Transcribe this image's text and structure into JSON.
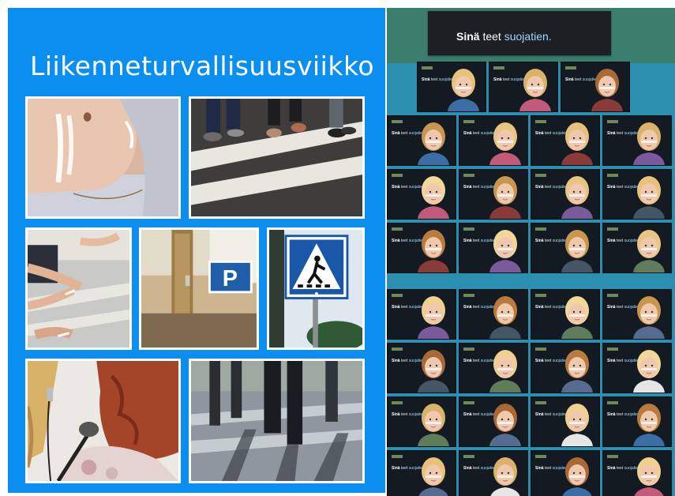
{
  "left_panel": {
    "title": "Liikenneturvallisuusviikko",
    "background_color": "#0a8ff0",
    "photos": [
      {
        "subject": "face-paint-photo"
      },
      {
        "subject": "crosswalk-feet-photo"
      },
      {
        "subject": "painted-hands-photo"
      },
      {
        "subject": "parking-sign-door-photo"
      },
      {
        "subject": "pedestrian-crossing-sign-photo"
      },
      {
        "subject": "microphone-photo"
      },
      {
        "subject": "street-shadows-photo"
      }
    ]
  },
  "right_panel": {
    "banner": {
      "bold": "Sinä",
      "normal": "teet",
      "light": "suojatien."
    },
    "poster_label": {
      "bold": "Sinä",
      "normal": "teet",
      "light": "suojatien."
    },
    "poster_count": 32,
    "background_color": "#2d8fb0"
  }
}
